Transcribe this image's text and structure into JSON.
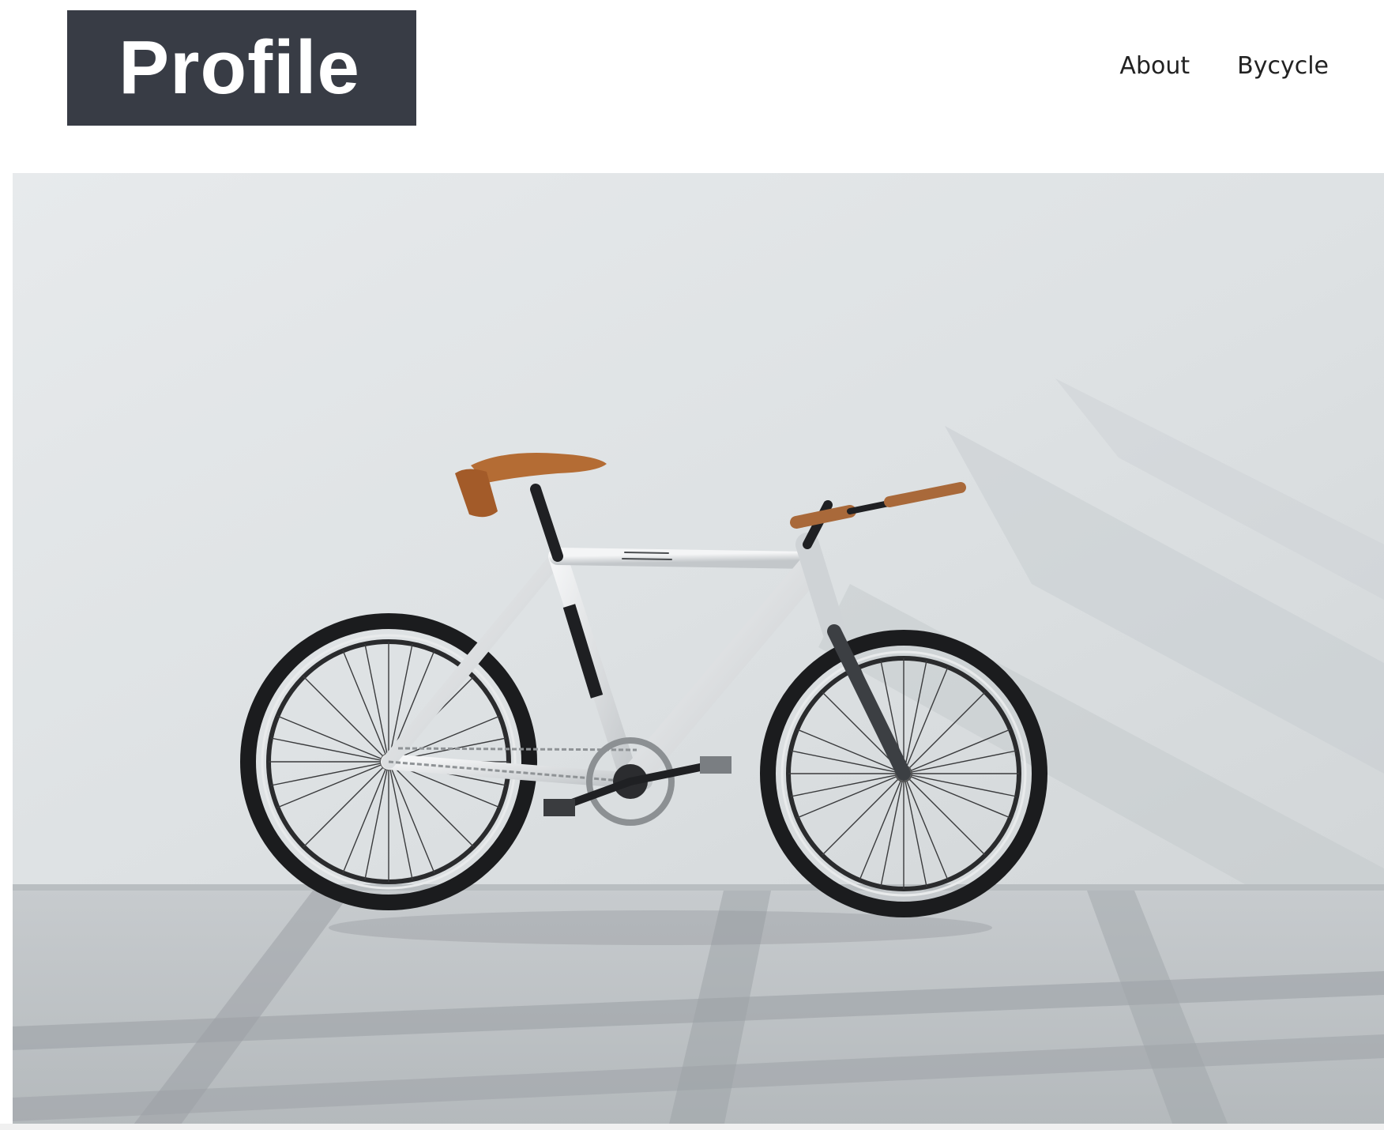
{
  "header": {
    "logo_text": "Profile",
    "nav": [
      {
        "label": "About"
      },
      {
        "label": "Bycycle"
      }
    ]
  },
  "hero": {
    "image_subject": "bicycle-photo"
  },
  "colors": {
    "logo_background": "#383c45",
    "logo_text": "#ffffff",
    "nav_text": "#222222",
    "page_background": "#ffffff"
  }
}
